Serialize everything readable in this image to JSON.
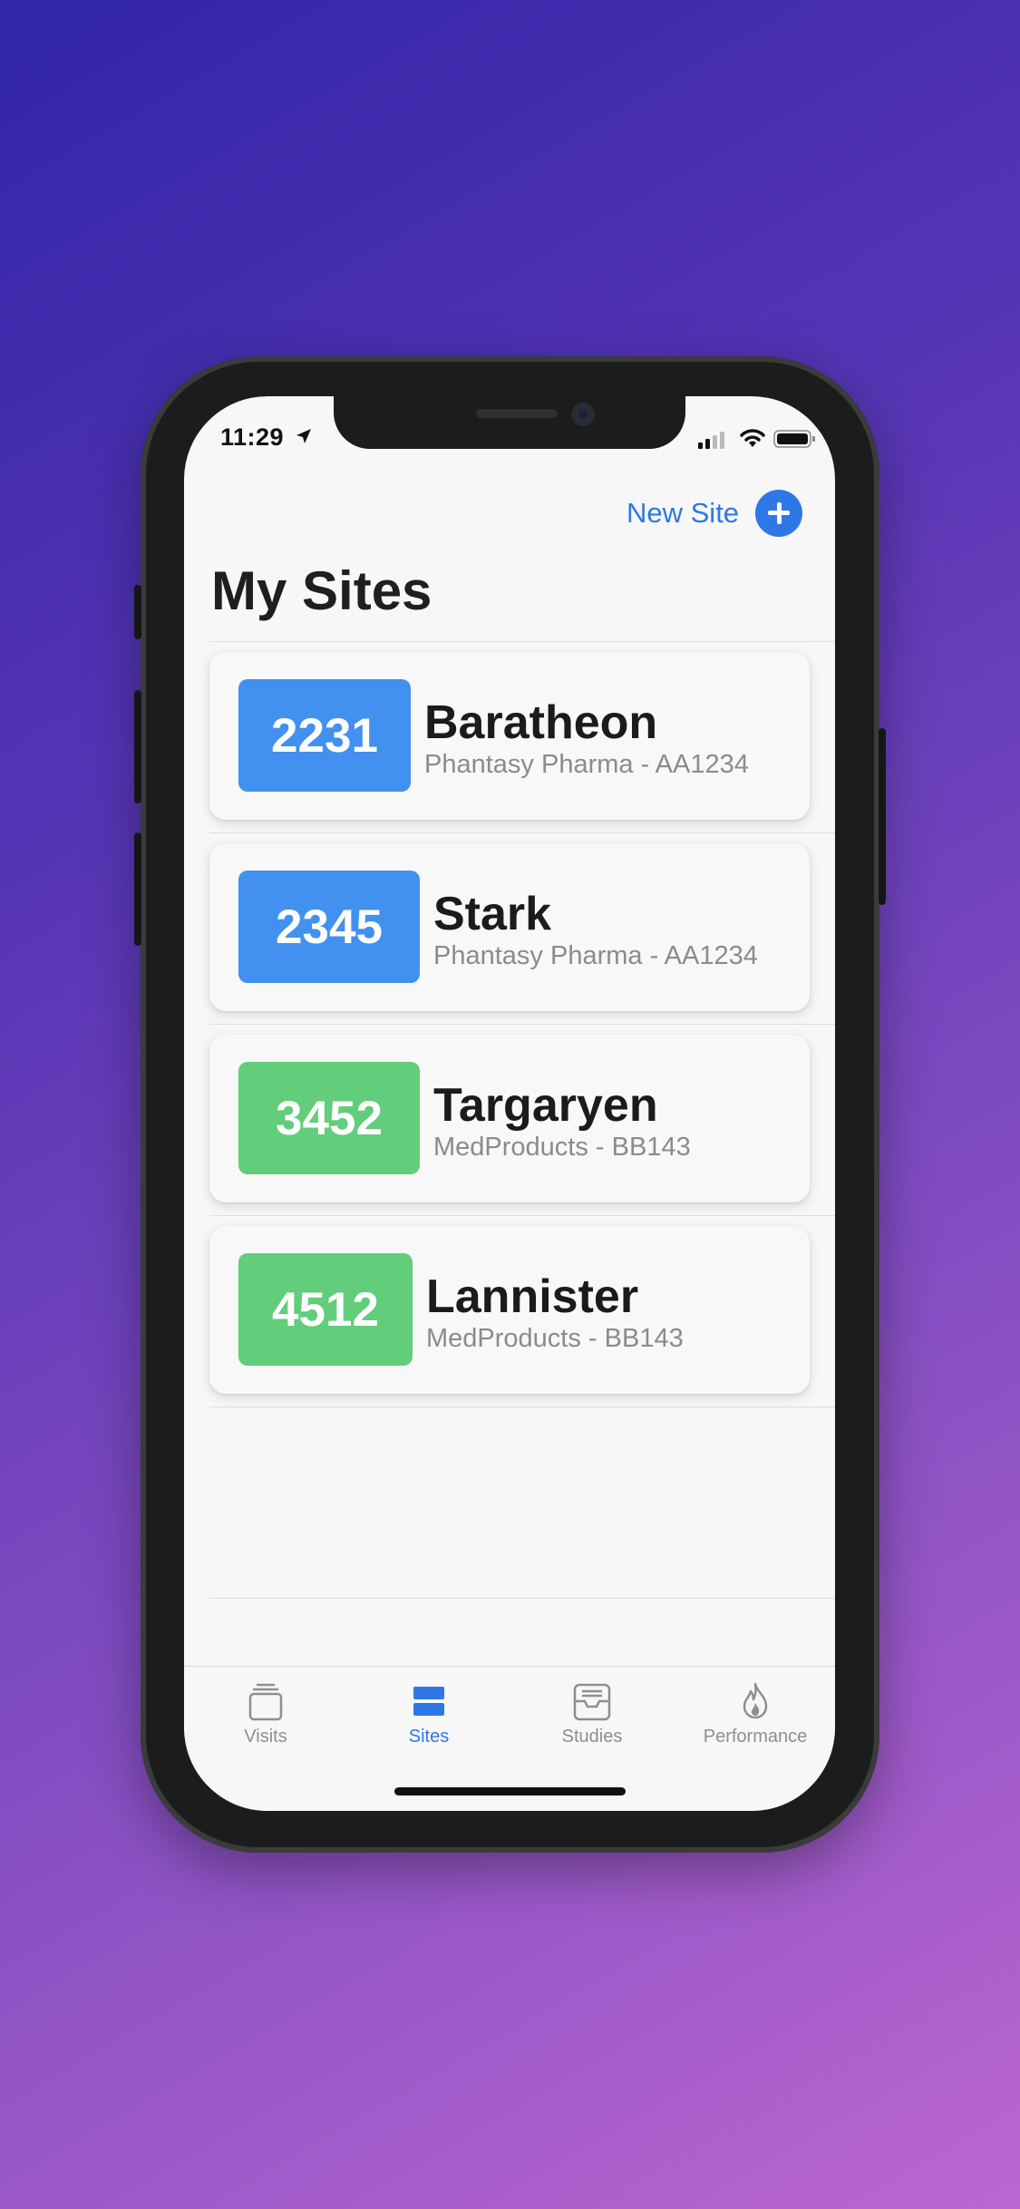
{
  "status_bar": {
    "time": "11:29"
  },
  "header": {
    "new_site_label": "New Site",
    "title": "My Sites"
  },
  "sites": [
    {
      "number": "2231",
      "name": "Baratheon",
      "subtitle": "Phantasy Pharma - AA1234",
      "color": "#4290f0"
    },
    {
      "number": "2345",
      "name": "Stark",
      "subtitle": "Phantasy Pharma - AA1234",
      "color": "#4290f0"
    },
    {
      "number": "3452",
      "name": "Targaryen",
      "subtitle": "MedProducts - BB143",
      "color": "#62cd7a"
    },
    {
      "number": "4512",
      "name": "Lannister",
      "subtitle": "MedProducts - BB143",
      "color": "#62cd7a"
    }
  ],
  "tabs": [
    {
      "label": "Visits",
      "icon": "visits-icon",
      "active": false
    },
    {
      "label": "Sites",
      "icon": "sites-icon",
      "active": true
    },
    {
      "label": "Studies",
      "icon": "studies-icon",
      "active": false
    },
    {
      "label": "Performance",
      "icon": "performance-icon",
      "active": false
    }
  ],
  "colors": {
    "accent": "#2e78e6",
    "blue_badge": "#4290f0",
    "green_badge": "#62cd7a"
  }
}
